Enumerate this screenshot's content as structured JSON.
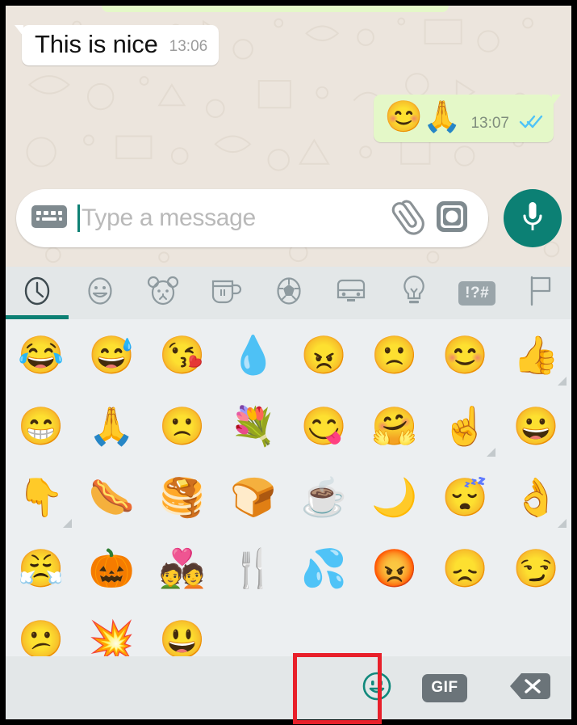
{
  "app": {
    "name": "WhatsApp",
    "accent_teal": "#0c8074",
    "chat_bg": "#ece5dd",
    "outgoing_bubble": "#e4f8c8",
    "incoming_bubble": "#ffffff",
    "keyboard_bg": "#eceff1",
    "tabbar_bg": "#e3e7e8",
    "highlight_box_color": "#e8202a"
  },
  "chat": {
    "messages": [
      {
        "direction": "incoming",
        "text": "This is nice",
        "time": "13:06"
      },
      {
        "direction": "outgoing",
        "text": "😊🙏",
        "time": "13:07",
        "status": "read",
        "ticks": "✓✓"
      }
    ]
  },
  "input_bar": {
    "keyboard_icon": "keyboard-icon",
    "placeholder": "Type a message",
    "value": "",
    "attach_icon": "paperclip-icon",
    "camera_icon": "camera-icon",
    "mic_icon": "microphone-icon"
  },
  "emoji_tabs": [
    {
      "key": "recent",
      "icon": "clock-icon",
      "active": true
    },
    {
      "key": "smileys",
      "icon": "smiley-icon",
      "active": false
    },
    {
      "key": "animals",
      "icon": "bear-icon",
      "active": false
    },
    {
      "key": "food",
      "icon": "cup-icon",
      "active": false
    },
    {
      "key": "sports",
      "icon": "soccerball-icon",
      "active": false
    },
    {
      "key": "travel",
      "icon": "car-icon",
      "active": false
    },
    {
      "key": "objects",
      "icon": "lightbulb-icon",
      "active": false
    },
    {
      "key": "symbols",
      "icon": "symbols-icon",
      "label": "!?#",
      "active": false
    },
    {
      "key": "flags",
      "icon": "flag-icon",
      "active": false
    }
  ],
  "emoji_grid": {
    "columns": 8,
    "rows": [
      [
        {
          "glyph": "😂",
          "name": "face-with-tears-of-joy",
          "variant": false
        },
        {
          "glyph": "😅",
          "name": "grinning-face-with-sweat",
          "variant": false
        },
        {
          "glyph": "😘",
          "name": "face-blowing-a-kiss",
          "variant": false
        },
        {
          "glyph": "💧",
          "name": "droplet",
          "variant": false
        },
        {
          "glyph": "😠",
          "name": "angry-face",
          "variant": false
        },
        {
          "glyph": "🙁",
          "name": "slightly-frowning-face",
          "variant": false
        },
        {
          "glyph": "😊",
          "name": "smiling-face-with-smiling-eyes",
          "variant": false
        },
        {
          "glyph": "👍",
          "name": "thumbs-up",
          "variant": true
        }
      ],
      [
        {
          "glyph": "😁",
          "name": "beaming-face-with-smiling-eyes",
          "variant": false
        },
        {
          "glyph": "🙏",
          "name": "folded-hands",
          "variant": false
        },
        {
          "glyph": "🙁",
          "name": "frowning-face",
          "variant": false
        },
        {
          "glyph": "💐",
          "name": "bouquet",
          "variant": false
        },
        {
          "glyph": "😋",
          "name": "face-savoring-food",
          "variant": false
        },
        {
          "glyph": "🤗",
          "name": "hugging-face",
          "variant": false
        },
        {
          "glyph": "☝️",
          "name": "index-pointing-up",
          "variant": true
        },
        {
          "glyph": "😀",
          "name": "grinning-face",
          "variant": false
        }
      ],
      [
        {
          "glyph": "👇",
          "name": "backhand-index-pointing-down",
          "variant": true
        },
        {
          "glyph": "🌭",
          "name": "hot-dog",
          "variant": false
        },
        {
          "glyph": "🥞",
          "name": "pancakes",
          "variant": false
        },
        {
          "glyph": "🍞",
          "name": "bread",
          "variant": false
        },
        {
          "glyph": "☕",
          "name": "hot-beverage",
          "variant": false
        },
        {
          "glyph": "🌙",
          "name": "crescent-moon",
          "variant": false
        },
        {
          "glyph": "😴",
          "name": "sleeping-face",
          "variant": false
        },
        {
          "glyph": "👌",
          "name": "ok-hand",
          "variant": true
        }
      ],
      [
        {
          "glyph": "😤",
          "name": "face-with-steam-from-nose",
          "variant": false
        },
        {
          "glyph": "🎃",
          "name": "jack-o-lantern",
          "variant": false
        },
        {
          "glyph": "💑",
          "name": "couple-with-heart",
          "variant": false
        },
        {
          "glyph": "🍴",
          "name": "fork-and-knife",
          "variant": false
        },
        {
          "glyph": "💦",
          "name": "sweat-droplets",
          "variant": false
        },
        {
          "glyph": "😡",
          "name": "pouting-face",
          "variant": false
        },
        {
          "glyph": "😞",
          "name": "disappointed-face",
          "variant": false
        },
        {
          "glyph": "😏",
          "name": "smirking-face",
          "variant": false
        }
      ],
      [
        {
          "glyph": "😕",
          "name": "confused-face",
          "variant": false
        },
        {
          "glyph": "💥",
          "name": "collision",
          "variant": false
        },
        {
          "glyph": "😃",
          "name": "grinning-face-with-big-eyes",
          "variant": false
        }
      ]
    ]
  },
  "bottom_bar": {
    "emoji_button": "smiley-icon",
    "gif_label": "GIF",
    "backspace_icon": "backspace-icon"
  }
}
